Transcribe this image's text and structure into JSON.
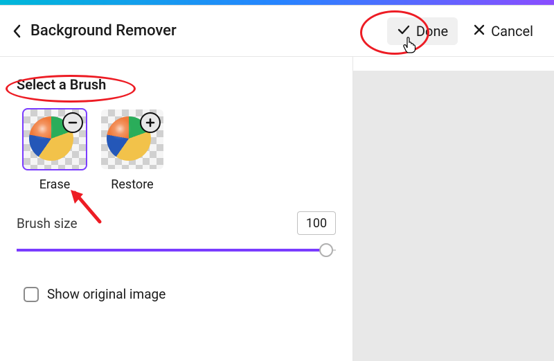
{
  "header": {
    "title": "Background Remover",
    "done_label": "Done",
    "cancel_label": "Cancel"
  },
  "brush": {
    "section_title": "Select a Brush",
    "erase_label": "Erase",
    "restore_label": "Restore"
  },
  "size": {
    "label": "Brush size",
    "value": "100",
    "percent": 97
  },
  "show_original": {
    "label": "Show original image",
    "checked": false
  }
}
